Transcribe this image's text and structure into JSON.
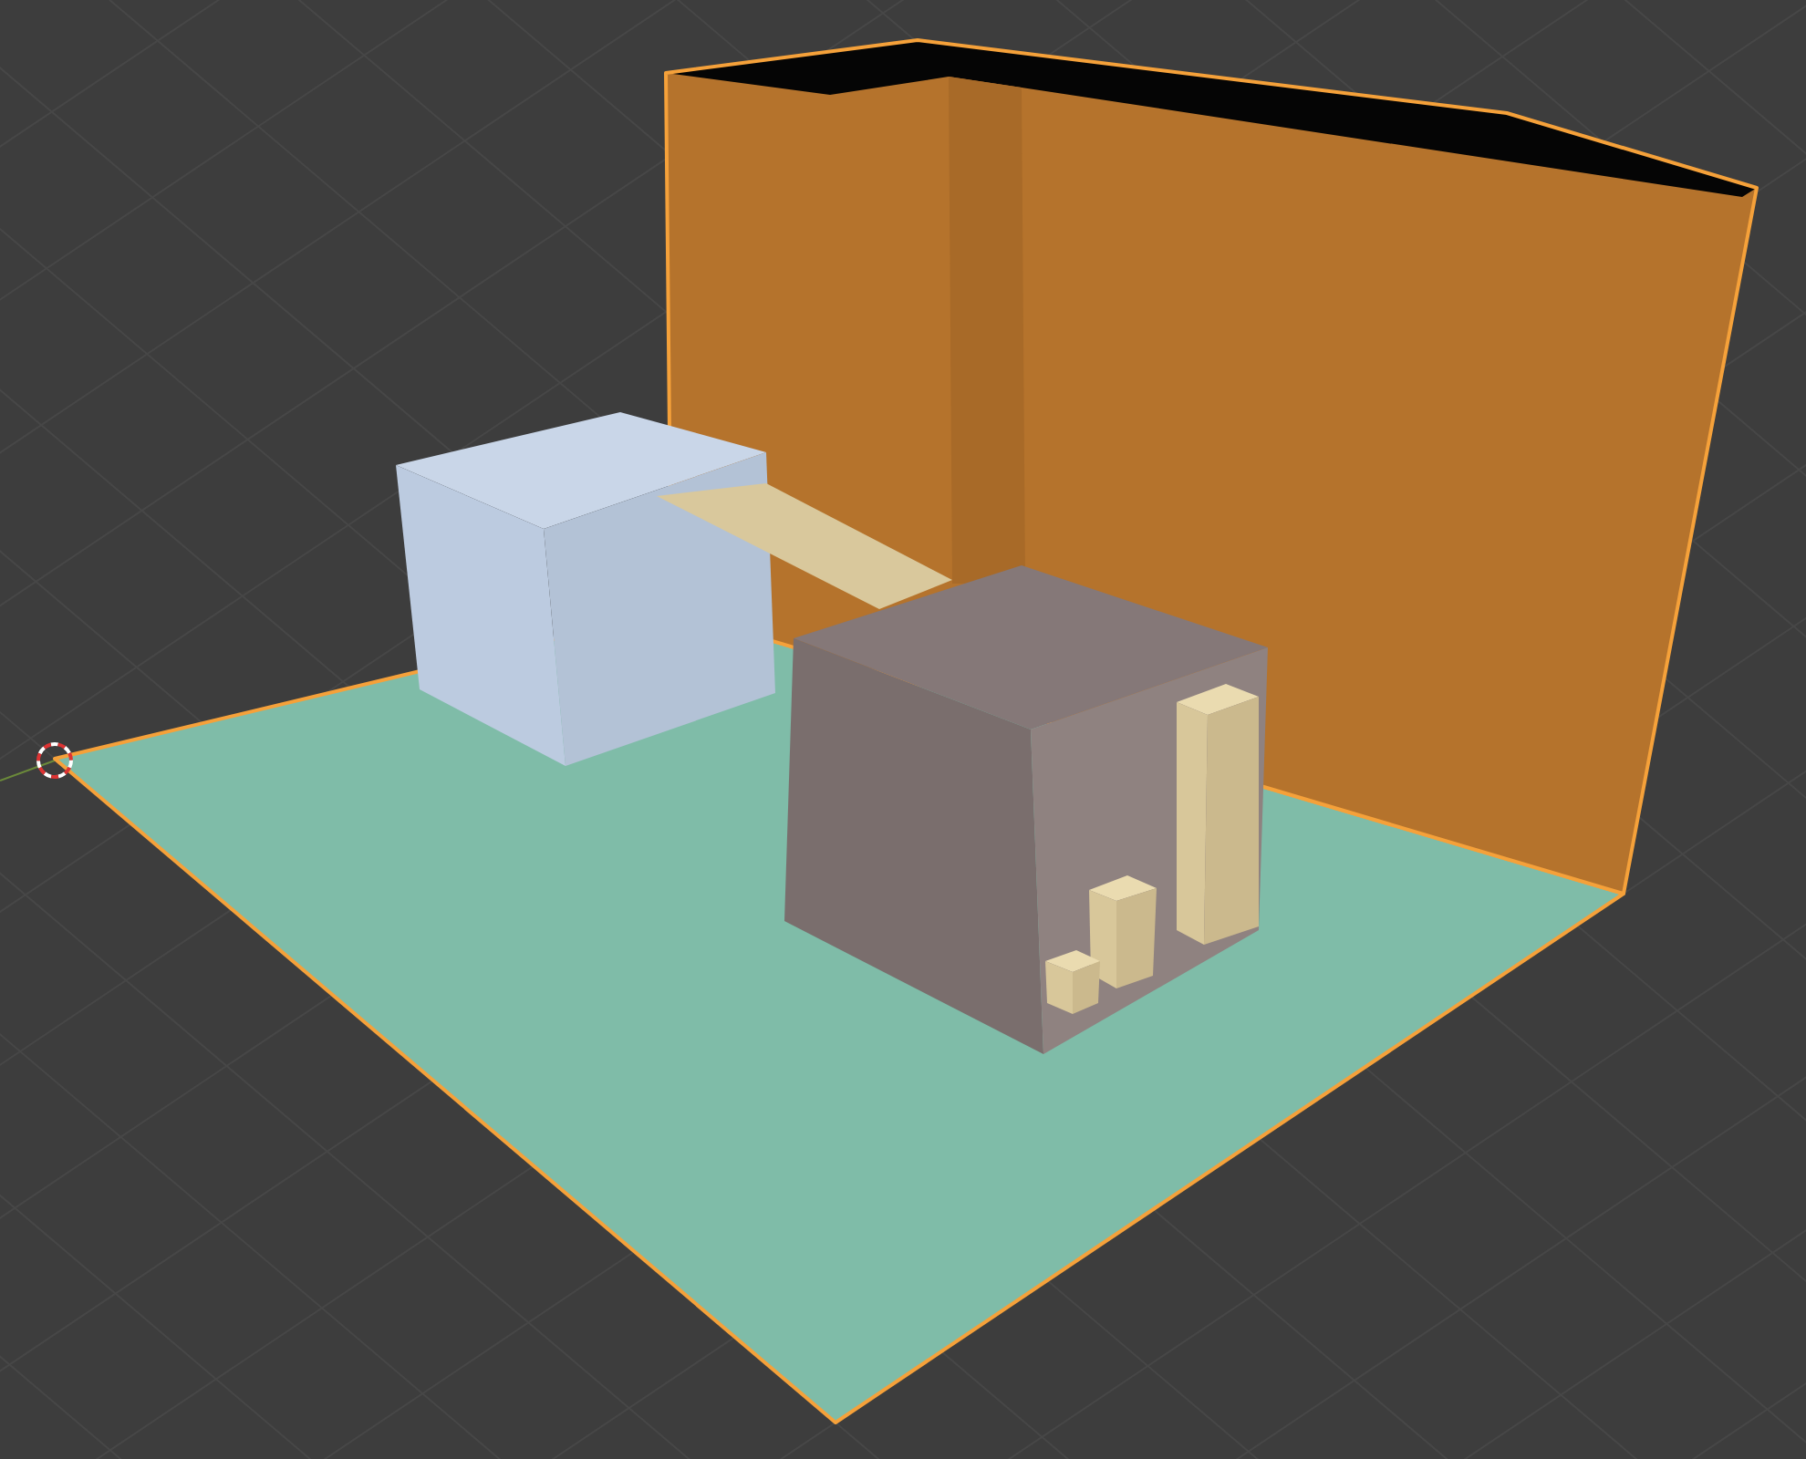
{
  "viewport": {
    "objects": [
      {
        "kind": "floor",
        "selected": true
      },
      {
        "kind": "wall",
        "selected": true
      },
      {
        "kind": "light-box",
        "selected": false
      },
      {
        "kind": "plank",
        "selected": false
      },
      {
        "kind": "dark-box",
        "selected": false
      },
      {
        "kind": "tall-post",
        "selected": false
      },
      {
        "kind": "medium-post",
        "selected": false
      },
      {
        "kind": "short-post",
        "selected": false
      }
    ]
  }
}
